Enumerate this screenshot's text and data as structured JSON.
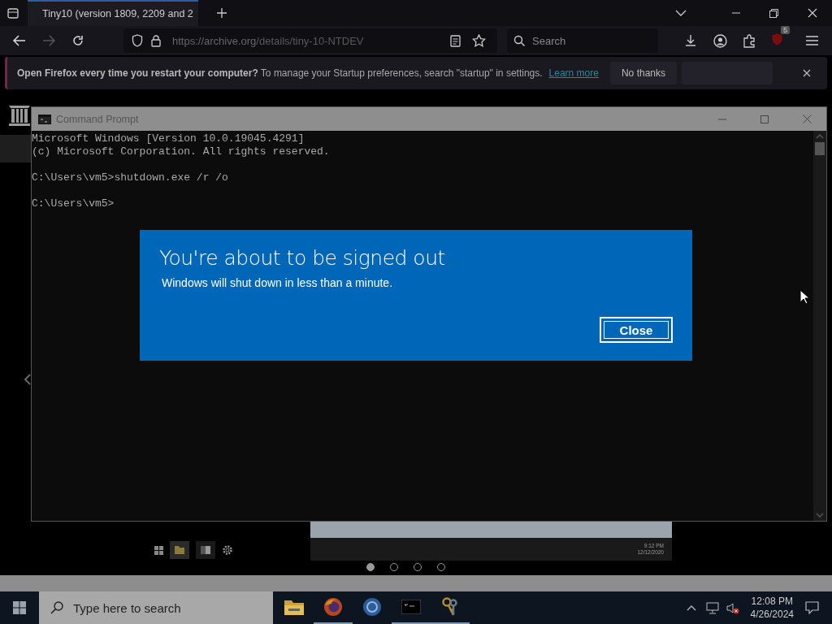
{
  "browser": {
    "tab": {
      "title": "Tiny10 (version 1809, 2209 and 2"
    },
    "address": {
      "url_host": "https://archive.org",
      "url_path": "/details/tiny-10-NTDEV"
    },
    "search": {
      "placeholder": "Search"
    },
    "extension_badge": "5",
    "notification": {
      "bold": "Open Firefox every time you restart your computer?",
      "text": "To manage your Startup preferences, search \"startup\" in settings.",
      "link": "Learn more",
      "button": "No thanks"
    }
  },
  "page": {
    "carousel": {
      "thumb_time": "9:12 PM",
      "thumb_date": "12/12/2020",
      "dots": [
        {
          "selected": true
        },
        {
          "selected": false
        },
        {
          "selected": false
        },
        {
          "selected": false
        }
      ]
    }
  },
  "command_prompt": {
    "title": "Command Prompt",
    "paragraphs": [
      [
        "Microsoft Windows [Version 10.0.19045.4291]",
        "(c) Microsoft Corporation. All rights reserved."
      ],
      [
        "C:\\Users\\vm5>shutdown.exe /r /o"
      ],
      [
        "C:\\Users\\vm5>"
      ]
    ]
  },
  "dialog": {
    "title": "You're about to be signed out",
    "message": "Windows will shut down in less than a minute.",
    "button": "Close"
  },
  "taskbar": {
    "search": {
      "placeholder": "Type here to search"
    },
    "apps": [
      {
        "kind": "folder",
        "running": false
      },
      {
        "kind": "firefox",
        "running": true
      },
      {
        "kind": "globe",
        "running": false
      },
      {
        "kind": "console",
        "running": true
      },
      {
        "kind": "keys",
        "running": true
      }
    ],
    "time": "12:08 PM",
    "date": "4/26/2024"
  }
}
